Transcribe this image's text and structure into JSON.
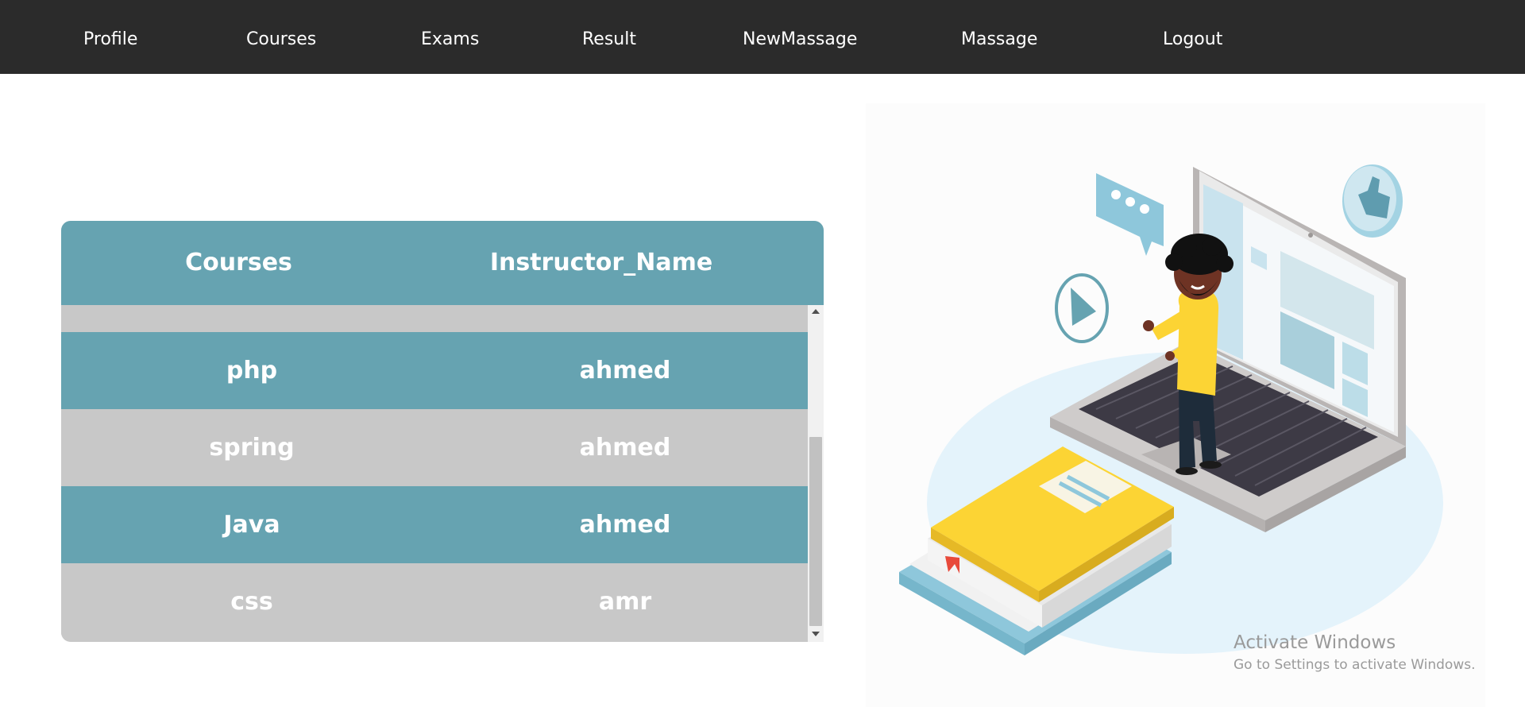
{
  "nav": {
    "items": [
      {
        "label": "Profile"
      },
      {
        "label": "Courses"
      },
      {
        "label": "Exams"
      },
      {
        "label": "Result"
      },
      {
        "label": "NewMassage"
      },
      {
        "label": "Massage"
      },
      {
        "label": "Logout"
      }
    ]
  },
  "table": {
    "headers": [
      "Courses",
      "Instructor_Name"
    ],
    "rows": [
      {
        "course": "php",
        "instructor": "ahmed"
      },
      {
        "course": "spring",
        "instructor": "ahmed"
      },
      {
        "course": "Java",
        "instructor": "ahmed"
      },
      {
        "course": "css",
        "instructor": "amr"
      }
    ]
  },
  "colors": {
    "navbar": "#2b2b2b",
    "table_header": "#66a3b1",
    "row_blue": "#66a3b1",
    "row_gray": "#c8c8c8"
  },
  "illustration": {
    "icons": [
      "chat-bubble-icon",
      "thumbs-up-icon",
      "play-icon",
      "laptop-icon",
      "book-icon"
    ]
  },
  "watermark": {
    "title": "Activate Windows",
    "subtitle": "Go to Settings to activate Windows."
  }
}
